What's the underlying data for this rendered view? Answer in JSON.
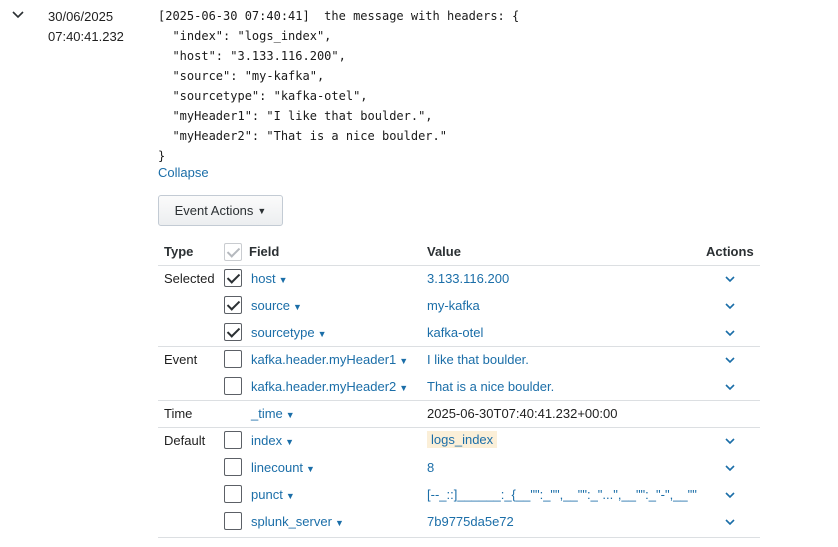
{
  "event": {
    "date": "30/06/2025",
    "time": "07:40:41.232",
    "raw_lines": [
      "[2025-06-30 07:40:41]  the message with headers: {",
      "  \"index\": \"logs_index\",",
      "  \"host\": \"3.133.116.200\",",
      "  \"source\": \"my-kafka\",",
      "  \"sourcetype\": \"kafka-otel\",",
      "  \"myHeader1\": \"I like that boulder.\",",
      "  \"myHeader2\": \"That is a nice boulder.\"",
      "}"
    ],
    "collapse_label": "Collapse",
    "event_actions_label": "Event Actions"
  },
  "table": {
    "headers": {
      "type": "Type",
      "field": "Field",
      "value": "Value",
      "actions": "Actions"
    },
    "rows": [
      {
        "type": "Selected",
        "checked": true,
        "field": "host",
        "value": "3.133.116.200"
      },
      {
        "type": "",
        "checked": true,
        "field": "source",
        "value": "my-kafka"
      },
      {
        "type": "",
        "checked": true,
        "field": "sourcetype",
        "value": "kafka-otel"
      },
      {
        "type": "Event",
        "checked": false,
        "field": "kafka.header.myHeader1",
        "value": "I like that boulder."
      },
      {
        "type": "",
        "checked": false,
        "field": "kafka.header.myHeader2",
        "value": "That is a nice boulder."
      },
      {
        "type": "Time",
        "checkbox": false,
        "field": "_time",
        "value": "2025-06-30T07:40:41.232+00:00",
        "no_action": true,
        "plain_value": true
      },
      {
        "type": "Default",
        "checked": false,
        "field": "index",
        "value": "logs_index",
        "highlight": true
      },
      {
        "type": "",
        "checked": false,
        "field": "linecount",
        "value": "8"
      },
      {
        "type": "",
        "checked": false,
        "field": "punct",
        "value": "[--_::]______:_{__\"\":_\"\",__\"\":_\"...\",__\"\":_\"-\",__\"\""
      },
      {
        "type": "",
        "checked": false,
        "field": "splunk_server",
        "value": "7b9775da5e72"
      }
    ]
  },
  "colors": {
    "link": "#1b6ea8",
    "text": "#1f1f1f",
    "highlight": "#fbefd8"
  }
}
